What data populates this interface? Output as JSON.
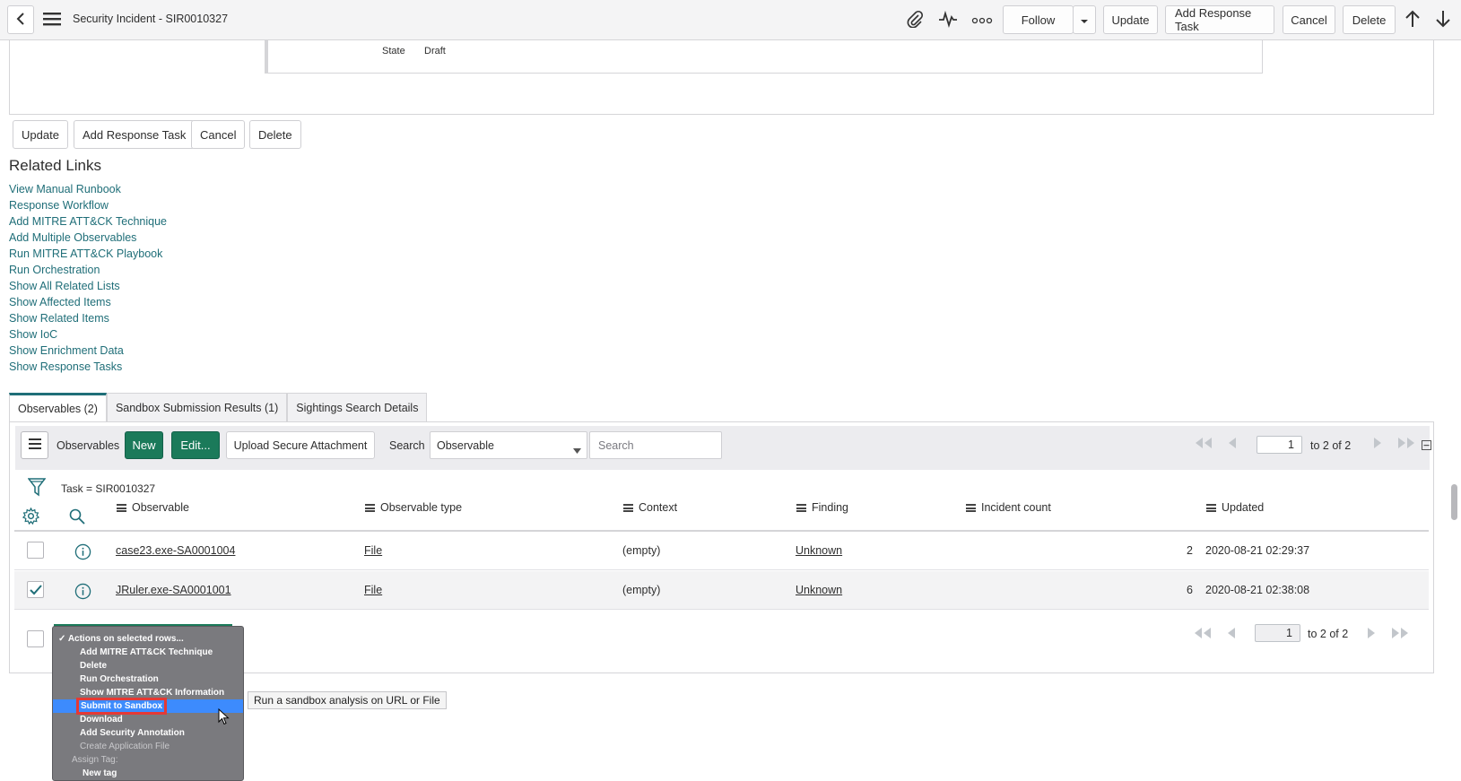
{
  "header": {
    "title": "Security Incident - SIR0010327",
    "follow": "Follow",
    "update": "Update",
    "add_response_task": "Add Response Task",
    "cancel": "Cancel",
    "delete": "Delete"
  },
  "form": {
    "state_label": "State",
    "state_value": "Draft"
  },
  "bottom_buttons": {
    "update": "Update",
    "add_response_task": "Add Response Task",
    "cancel": "Cancel",
    "delete": "Delete"
  },
  "related_links": {
    "title": "Related Links",
    "items": [
      "View Manual Runbook",
      "Response Workflow",
      "Add MITRE ATT&CK Technique",
      "Add Multiple Observables",
      "Run MITRE ATT&CK Playbook",
      "Run Orchestration",
      "Show All Related Lists",
      "Show Affected Items",
      "Show Related Items",
      "Show IoC",
      "Show Enrichment Data",
      "Show Response Tasks"
    ]
  },
  "tabs": [
    "Observables (2)",
    "Sandbox Submission Results (1)",
    "Sightings Search Details"
  ],
  "list": {
    "label": "Observables",
    "new_btn": "New",
    "edit_btn": "Edit...",
    "upload_btn": "Upload Secure Attachment",
    "search_label": "Search",
    "search_field": "Observable",
    "search_placeholder": "Search",
    "page": "1",
    "page_of": "to 2 of 2",
    "filter": "Task = SIR0010327",
    "columns": [
      "Observable",
      "Observable type",
      "Context",
      "Finding",
      "Incident count",
      "Updated"
    ],
    "rows": [
      {
        "observable": "case23.exe-SA0001004",
        "type": "File",
        "context": "(empty)",
        "finding": "Unknown",
        "count": "2",
        "updated": "2020-08-21 02:29:37",
        "checked": false
      },
      {
        "observable": "JRuler.exe-SA0001001",
        "type": "File",
        "context": "(empty)",
        "finding": "Unknown",
        "count": "6",
        "updated": "2020-08-21 02:38:08",
        "checked": true
      }
    ]
  },
  "actions_menu": {
    "items": [
      "Actions on selected rows...",
      "Add MITRE ATT&CK Technique",
      "Delete",
      "Run Orchestration",
      "Show MITRE ATT&CK Information",
      "Submit to Sandbox",
      "Download",
      "Add Security Annotation",
      "Create Application File",
      "Assign Tag:",
      "New tag"
    ],
    "highlighted": "Submit to Sandbox"
  },
  "tooltip": "Run a sandbox analysis on URL or File",
  "colors": {
    "accent": "#1f6e78",
    "new_button": "#1b7a5a",
    "menu_highlight": "#3d8bfd",
    "highlight_box": "#e53935"
  }
}
